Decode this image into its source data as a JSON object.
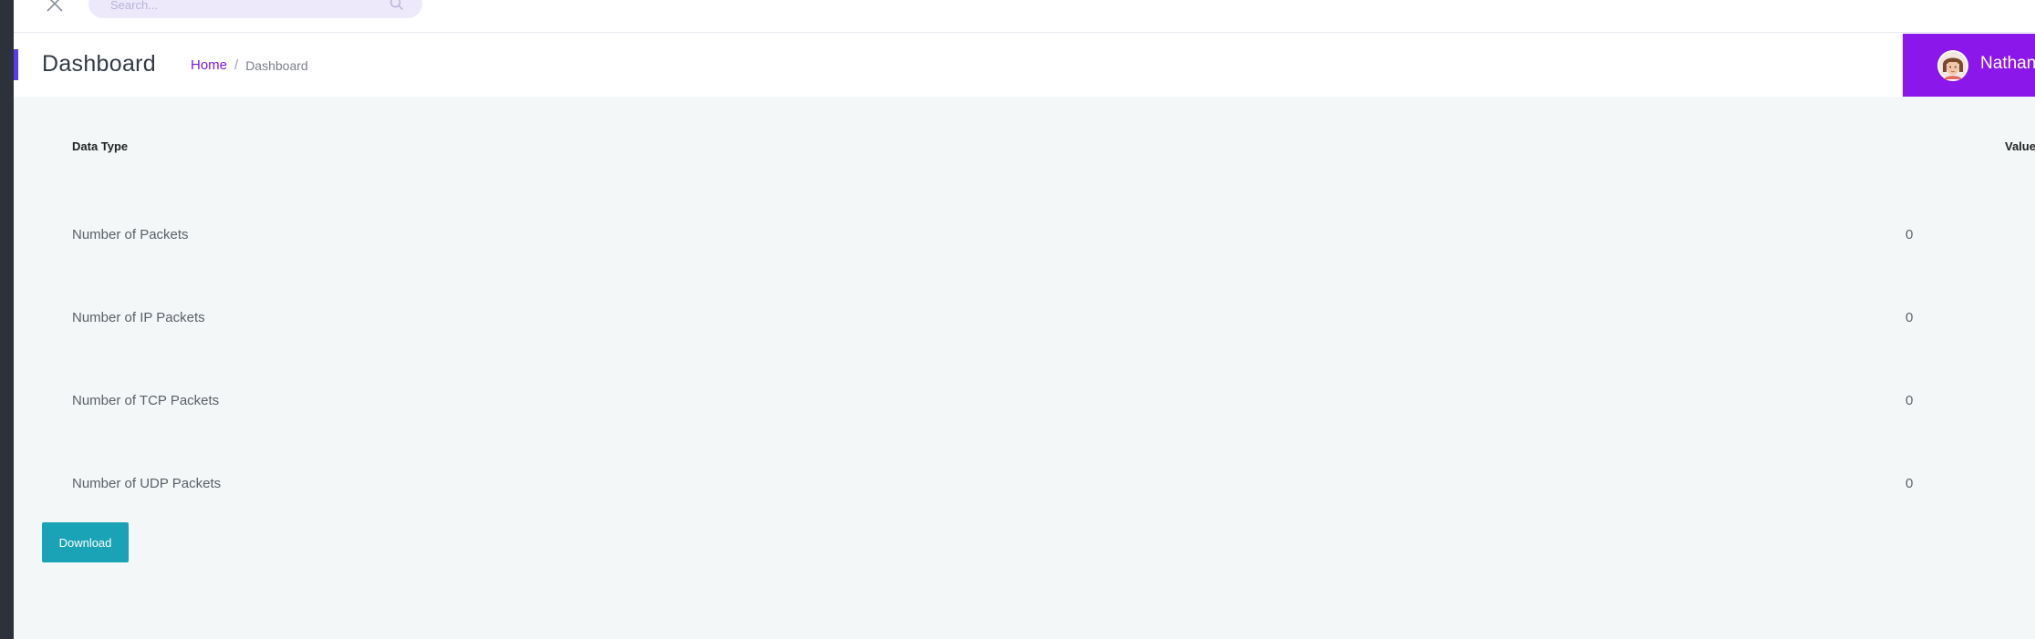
{
  "search": {
    "placeholder": "Search..."
  },
  "header": {
    "title": "Dashboard",
    "breadcrumb": {
      "home": "Home",
      "separator": "/",
      "current": "Dashboard"
    }
  },
  "user": {
    "name": "Nathan"
  },
  "table": {
    "columns": {
      "type": "Data Type",
      "value": "Value"
    },
    "rows": [
      {
        "type": "Number of Packets",
        "value": "0"
      },
      {
        "type": "Number of IP Packets",
        "value": "0"
      },
      {
        "type": "Number of TCP Packets",
        "value": "0"
      },
      {
        "type": "Number of UDP Packets",
        "value": "0"
      }
    ]
  },
  "actions": {
    "download_label": "Download"
  },
  "colors": {
    "accent": "#8b17ea",
    "link": "#7b16e6",
    "button": "#1aa3b6",
    "sidebar": "#2d3139"
  },
  "icons": {
    "close": "close-icon",
    "search": "search-icon",
    "avatar": "user-avatar"
  }
}
